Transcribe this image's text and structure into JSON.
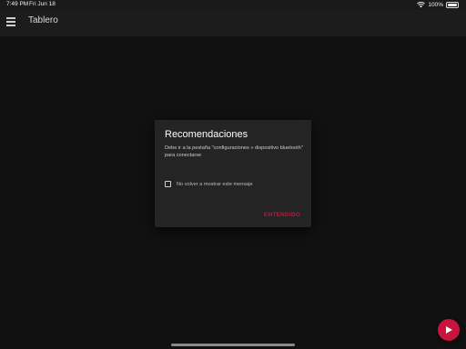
{
  "status_bar": {
    "time": "7:49 PM",
    "date": "Fri Jun 18",
    "battery": "100%"
  },
  "app_bar": {
    "title": "Tablero",
    "menu_icon": "hamburger-menu-icon"
  },
  "dialog": {
    "title": "Recomendaciones",
    "message": "Debe ir a la pestaña \"configuraciones » dispositivo bluetooth\" para conectarse",
    "checkbox_label": "No volver a mostrar este mensaje",
    "checkbox_checked": false,
    "button_label": "ENTENDIDO"
  },
  "fab": {
    "icon": "play-icon"
  },
  "colors": {
    "accent": "#c8143e",
    "background": "#111111",
    "dialog_background": "#242424"
  }
}
